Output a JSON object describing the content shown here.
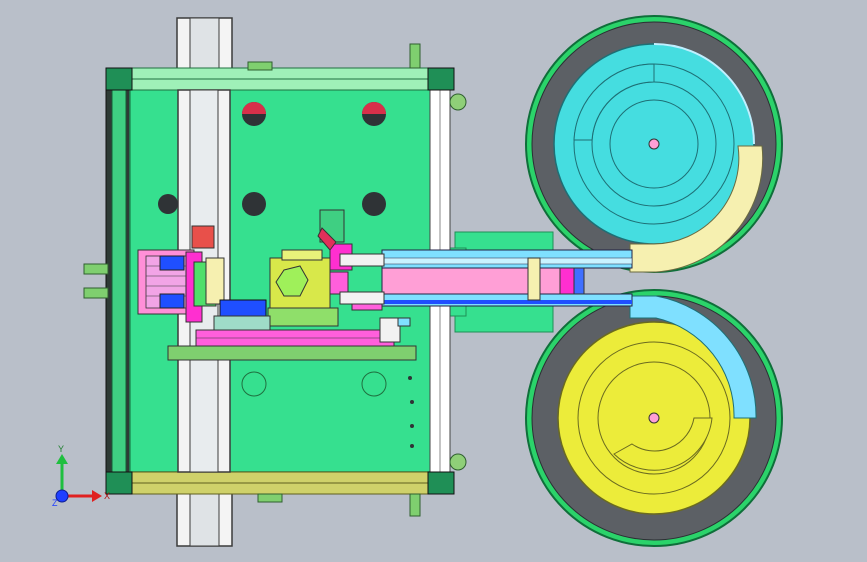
{
  "view": {
    "background": "#b9bfc9"
  },
  "triad": {
    "x_label": "X",
    "y_label": "Y",
    "z_label": "Z"
  },
  "colors": {
    "frame_green": "#36e08f",
    "frame_dark": "#1f8f56",
    "bowl_rim_green": "#2bd36a",
    "bowl_dark": "#5c6065",
    "bowl_top_inner": "#45dde0",
    "bowl_bottom_inner": "#ecec3a",
    "track_pink": "#ff9fd6",
    "track_cyan": "#7fe0ff",
    "magenta": "#ff2fd0",
    "blue": "#1f4fff",
    "cream": "#f6f0b0",
    "light_cyan": "#bfefff",
    "hole_red": "#d8304a"
  }
}
